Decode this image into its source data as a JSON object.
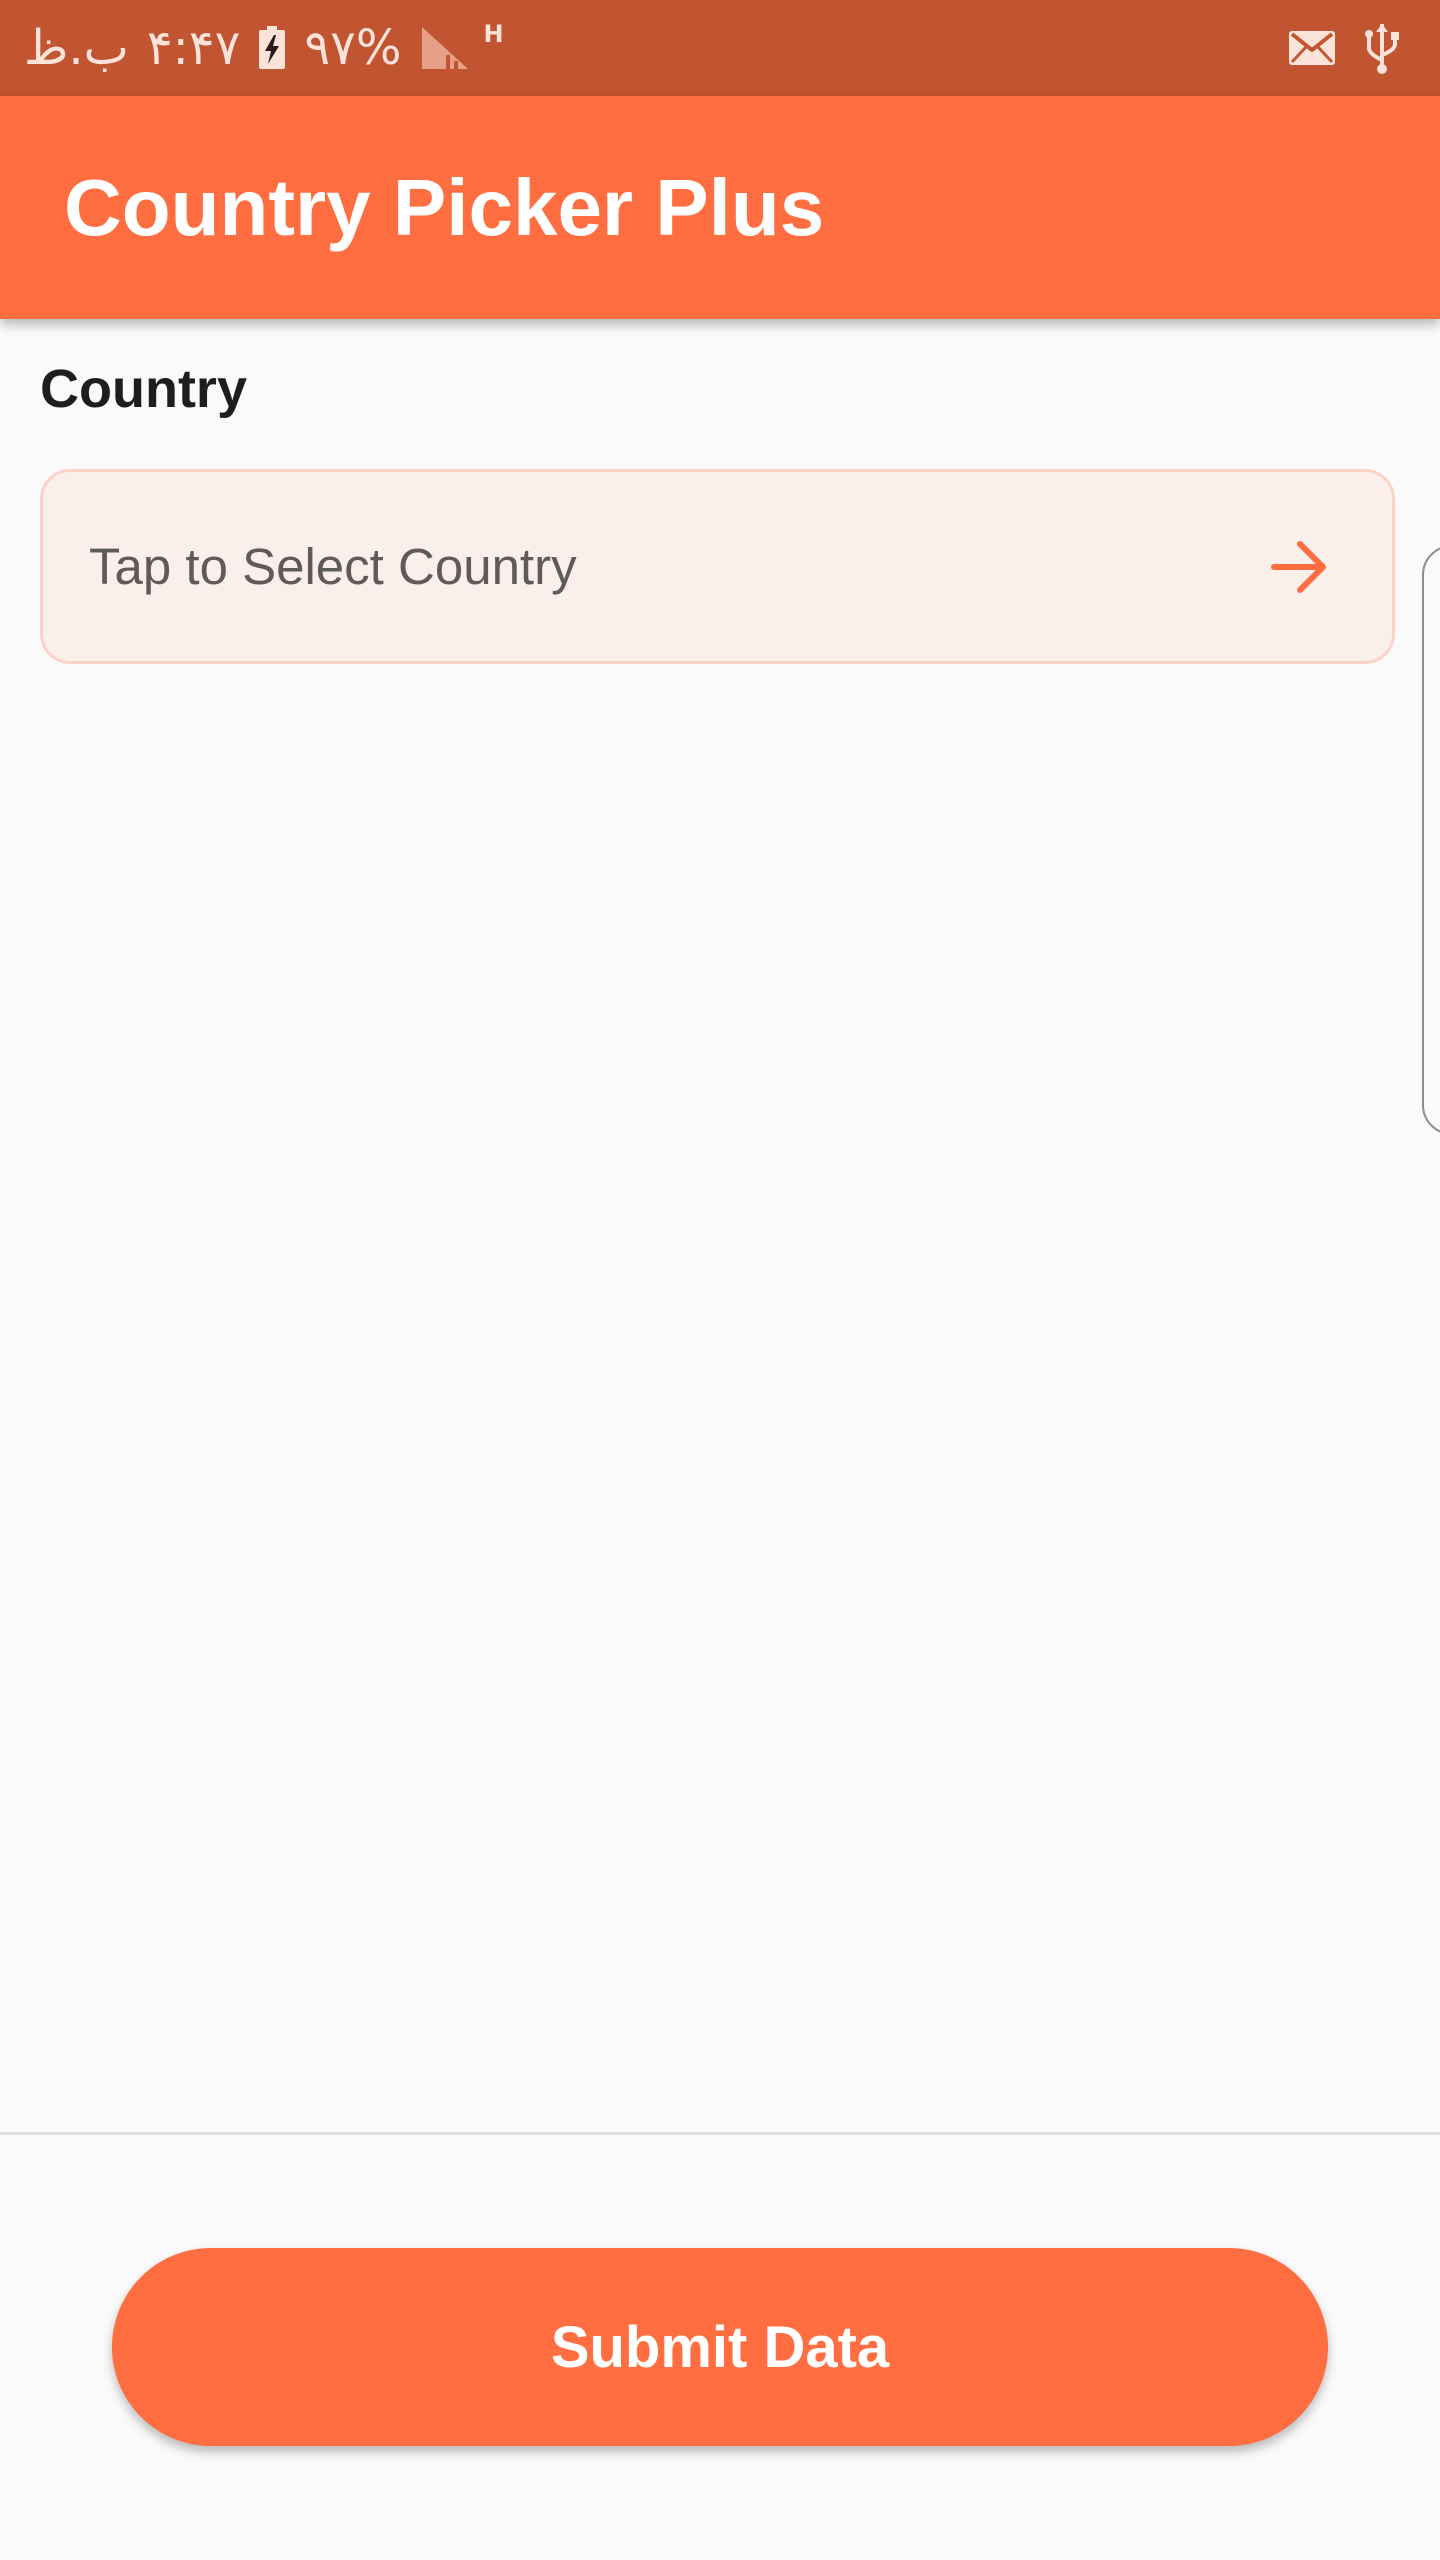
{
  "status_bar": {
    "period": "ب.ظ",
    "time": "۴:۴۷",
    "battery": "۹۷%",
    "network_type": "H",
    "icons": {
      "battery": "battery-charging-icon",
      "signal": "signal-icon",
      "mail": "mail-icon",
      "usb": "usb-icon"
    }
  },
  "app_bar": {
    "title": "Country Picker Plus"
  },
  "form": {
    "country_label": "Country",
    "country_placeholder": "Tap to Select Country",
    "country_icon": "arrow-right-icon"
  },
  "footer": {
    "submit_label": "Submit Data"
  },
  "colors": {
    "accent": "#ff6e40",
    "status_bar": "#c15431",
    "background": "#fafafa",
    "field_background": "#fbefec",
    "field_border": "#fbd2c6"
  }
}
